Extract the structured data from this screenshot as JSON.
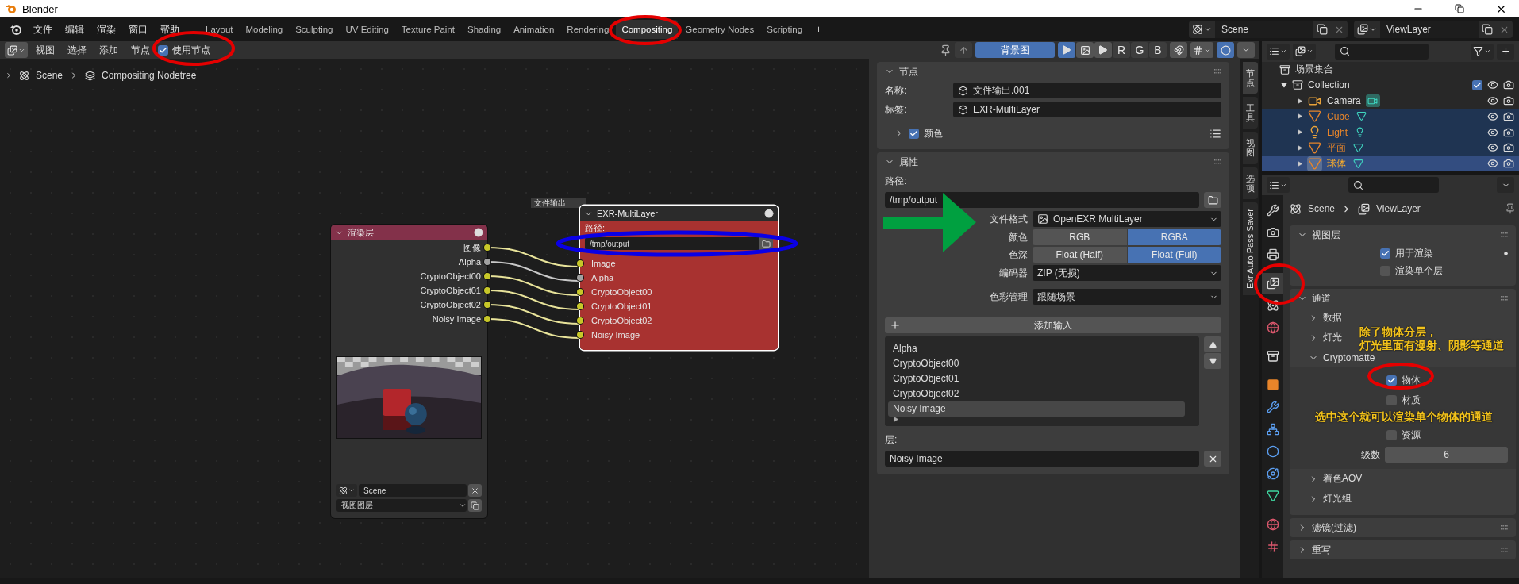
{
  "title_bar": {
    "title": "Blender"
  },
  "menu": [
    "文件",
    "编辑",
    "渲染",
    "窗口",
    "帮助"
  ],
  "workspaces": [
    {
      "label": "Layout",
      "selected": false
    },
    {
      "label": "Modeling",
      "selected": false
    },
    {
      "label": "Sculpting",
      "selected": false
    },
    {
      "label": "UV Editing",
      "selected": false
    },
    {
      "label": "Texture Paint",
      "selected": false
    },
    {
      "label": "Shading",
      "selected": false
    },
    {
      "label": "Animation",
      "selected": false
    },
    {
      "label": "Rendering",
      "selected": false
    },
    {
      "label": "Compositing",
      "selected": true
    },
    {
      "label": "Geometry Nodes",
      "selected": false
    },
    {
      "label": "Scripting",
      "selected": false
    }
  ],
  "add_workspace": "+",
  "scene_selector": {
    "scene": "Scene",
    "view_layer": "ViewLayer"
  },
  "node_header": {
    "menus": [
      "视图",
      "选择",
      "添加",
      "节点"
    ],
    "use_nodes": {
      "label": "使用节点",
      "checked": true
    },
    "backdrop_button": "背景图",
    "display_modes": [
      {
        "kind": "icon",
        "selected": true
      },
      {
        "kind": "icon",
        "selected": false
      },
      {
        "kind": "icon",
        "selected": false
      },
      {
        "kind": "letter",
        "label": "R",
        "selected": false
      },
      {
        "kind": "letter",
        "label": "G",
        "selected": false
      },
      {
        "kind": "letter",
        "label": "B",
        "selected": false
      }
    ]
  },
  "breadcrumb": [
    "Scene",
    "Compositing Nodetree"
  ],
  "render_layers_node": {
    "title": "渲染层",
    "outputs": [
      {
        "label": "图像",
        "kind": "color"
      },
      {
        "label": "Alpha",
        "kind": "value"
      },
      {
        "label": "CryptoObject00",
        "kind": "color"
      },
      {
        "label": "CryptoObject01",
        "kind": "color"
      },
      {
        "label": "CryptoObject02",
        "kind": "color"
      },
      {
        "label": "Noisy Image",
        "kind": "color"
      }
    ],
    "scene": "Scene",
    "view_layer": "视图图层"
  },
  "file_output_node": {
    "frame_label": "文件输出",
    "title": "EXR-MultiLayer",
    "selected": true,
    "path_label": "路径:",
    "path": "/tmp/output",
    "inputs": [
      {
        "label": "Image",
        "kind": "color"
      },
      {
        "label": "Alpha",
        "kind": "value"
      },
      {
        "label": "CryptoObject00",
        "kind": "color"
      },
      {
        "label": "CryptoObject01",
        "kind": "color"
      },
      {
        "label": "CryptoObject02",
        "kind": "color"
      },
      {
        "label": "Noisy Image",
        "kind": "color"
      }
    ]
  },
  "sidebar": {
    "tabs": [
      {
        "label": "节点",
        "selected": true
      },
      {
        "label": "工具",
        "selected": false
      },
      {
        "label": "视图",
        "selected": false
      },
      {
        "label": "选项",
        "selected": false
      },
      {
        "label": "Exr Auto Pass Saver",
        "selected": false
      }
    ],
    "node_panel": {
      "title": "节点",
      "expanded": true,
      "name_label": "名称:",
      "name": "文件输出.001",
      "label_label": "标签:",
      "label": "EXR-MultiLayer",
      "color": {
        "label": "颜色",
        "checked": true,
        "expanded": false
      }
    },
    "properties_panel": {
      "title": "属性",
      "expanded": true,
      "path_label": "路径:",
      "path": "/tmp/output",
      "format": {
        "label": "文件格式",
        "value": "OpenEXR MultiLayer"
      },
      "color_mode": {
        "label": "颜色",
        "options": [
          {
            "label": "RGB",
            "selected": false
          },
          {
            "label": "RGBA",
            "selected": true
          }
        ]
      },
      "depth": {
        "label": "色深",
        "options": [
          {
            "label": "Float (Half)",
            "selected": false
          },
          {
            "label": "Float (Full)",
            "selected": true
          }
        ]
      },
      "codec": {
        "label": "编码器",
        "value": "ZIP (无损)"
      },
      "color_management": {
        "label": "色彩管理",
        "value": "跟随场景"
      },
      "add_input": "添加输入",
      "inputs": [
        {
          "label": "Alpha",
          "selected": false
        },
        {
          "label": "CryptoObject00",
          "selected": false
        },
        {
          "label": "CryptoObject01",
          "selected": false
        },
        {
          "label": "CryptoObject02",
          "selected": false
        },
        {
          "label": "Noisy Image",
          "selected": true
        }
      ],
      "layer_label": "层:",
      "layer": "Noisy Image"
    }
  },
  "outliner": {
    "root": "场景集合",
    "collections": [
      {
        "name": "Collection",
        "expanded": true,
        "checked": true,
        "children": [
          {
            "name": "Camera",
            "kind": "camera",
            "expanded": false,
            "selected": false,
            "active": false
          },
          {
            "name": "Cube",
            "kind": "mesh",
            "expanded": false,
            "selected": true,
            "active": false
          },
          {
            "name": "Light",
            "kind": "light",
            "expanded": false,
            "selected": true,
            "active": false
          },
          {
            "name": "平面",
            "kind": "mesh",
            "expanded": false,
            "selected": true,
            "active": false
          },
          {
            "name": "球体",
            "kind": "mesh",
            "expanded": false,
            "selected": true,
            "active": true
          }
        ]
      }
    ]
  },
  "properties": {
    "breadcrumb": [
      "Scene",
      "ViewLayer"
    ],
    "tabs": [
      {
        "kind": "tool",
        "selected": false
      },
      {
        "kind": "render",
        "selected": false
      },
      {
        "kind": "output",
        "selected": false
      },
      {
        "kind": "view_layer",
        "selected": true
      },
      {
        "kind": "scene",
        "selected": false
      },
      {
        "kind": "world",
        "selected": false
      },
      {
        "kind": "collection",
        "selected": false
      },
      {
        "kind": "object",
        "selected": false
      },
      {
        "kind": "modifiers",
        "selected": false
      },
      {
        "kind": "particles",
        "selected": false
      },
      {
        "kind": "physics",
        "selected": false
      },
      {
        "kind": "constraints",
        "selected": false
      },
      {
        "kind": "data",
        "selected": false
      },
      {
        "kind": "material",
        "selected": false
      },
      {
        "kind": "texture",
        "selected": false
      }
    ],
    "view_layer_panel": {
      "title": "视图层",
      "expanded": true,
      "options": [
        {
          "label": "用于渲染",
          "checked": true
        },
        {
          "label": "渲染单个层",
          "checked": false
        }
      ]
    },
    "passes_panel": {
      "title": "通道",
      "expanded": true,
      "subpanels": [
        {
          "title": "数据",
          "expanded": false
        },
        {
          "title": "灯光",
          "expanded": false
        },
        {
          "title": "Cryptomatte",
          "expanded": true,
          "options": [
            {
              "label": "物体",
              "checked": true
            },
            {
              "label": "材质",
              "checked": false
            },
            {
              "label": "资源",
              "checked": false
            }
          ],
          "levels_label": "级数",
          "levels": "6"
        },
        {
          "title": "着色AOV",
          "expanded": false
        },
        {
          "title": "灯光组",
          "expanded": false
        }
      ]
    },
    "collapsed_panels": [
      {
        "title": "滤镜(过滤)",
        "expanded": false
      },
      {
        "title": "重写",
        "expanded": false
      }
    ]
  },
  "annotations": {
    "circles": [
      {
        "color": "#e50000"
      },
      {
        "color": "#e50000"
      },
      {
        "color": "#0a00e6"
      },
      {
        "color": "#e50000"
      },
      {
        "color": "#e50000"
      }
    ],
    "notes": [
      {
        "lines": [
          "除了物体分层，",
          "灯光里面有漫射、阴影等通道"
        ]
      },
      {
        "lines": [
          "选中这个就可以渲染单个物体的通道"
        ]
      }
    ]
  }
}
